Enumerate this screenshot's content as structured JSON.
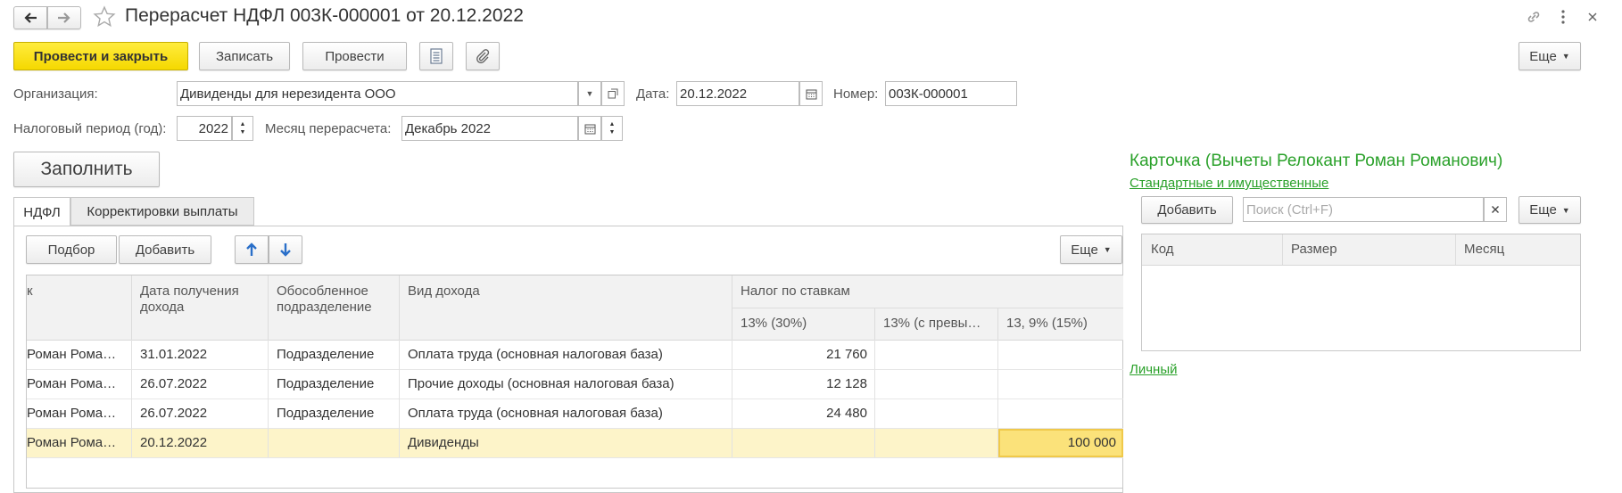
{
  "window": {
    "title": "Перерасчет НДФЛ 003К-000001 от 20.12.2022"
  },
  "toolbar": {
    "post_close": "Провести и закрыть",
    "save": "Записать",
    "post": "Провести",
    "more": "Еще"
  },
  "form": {
    "org_label": "Организация:",
    "org_value": "Дивиденды для нерезидента ООО",
    "date_label": "Дата:",
    "date_value": "20.12.2022",
    "number_label": "Номер:",
    "number_value": "003К-000001",
    "period_label": "Налоговый период (год):",
    "period_value": "2022",
    "month_label": "Месяц перерасчета:",
    "month_value": "Декабрь 2022",
    "fill_button": "Заполнить"
  },
  "tabs": [
    {
      "label": "НДФЛ"
    },
    {
      "label": "Корректировки выплаты"
    }
  ],
  "table_toolbar": {
    "pick": "Подбор",
    "add": "Добавить",
    "more": "Еще"
  },
  "table": {
    "headers": {
      "employee": "к",
      "date": "Дата получения дохода",
      "division": "Обособленное подразделение",
      "income": "Вид дохода",
      "tax_group": "Налог по ставкам",
      "rate1": "13% (30%)",
      "rate2": "13% (с превы…",
      "rate3": "13, 9% (15%)"
    },
    "rows": [
      {
        "employee": "Роман Рома…",
        "date": "31.01.2022",
        "division": "Подразделение",
        "income": "Оплата труда (основная налоговая база)",
        "rate1": "21 760",
        "rate2": "",
        "rate3": ""
      },
      {
        "employee": "Роман Рома…",
        "date": "26.07.2022",
        "division": "Подразделение",
        "income": "Прочие доходы (основная налоговая база)",
        "rate1": "12 128",
        "rate2": "",
        "rate3": ""
      },
      {
        "employee": "Роман Рома…",
        "date": "26.07.2022",
        "division": "Подразделение",
        "income": "Оплата труда (основная налоговая база)",
        "rate1": "24 480",
        "rate2": "",
        "rate3": ""
      },
      {
        "employee": "Роман Рома…",
        "date": "20.12.2022",
        "division": "",
        "income": "Дивиденды",
        "rate1": "",
        "rate2": "",
        "rate3": "100 000"
      }
    ]
  },
  "card": {
    "title": "Карточка (Вычеты Релокант Роман Романович)",
    "link_std": "Стандартные и имущественные",
    "add": "Добавить",
    "search_placeholder": "Поиск (Ctrl+F)",
    "more": "Еще",
    "headers": {
      "code": "Код",
      "size": "Размер",
      "month": "Месяц"
    },
    "link_personal": "Личный"
  },
  "colors": {
    "accent_green": "#2aa12a",
    "primary_yellow": "#f5d800",
    "selected_row": "#fdf4c9",
    "selected_cell": "#fbe27a"
  }
}
